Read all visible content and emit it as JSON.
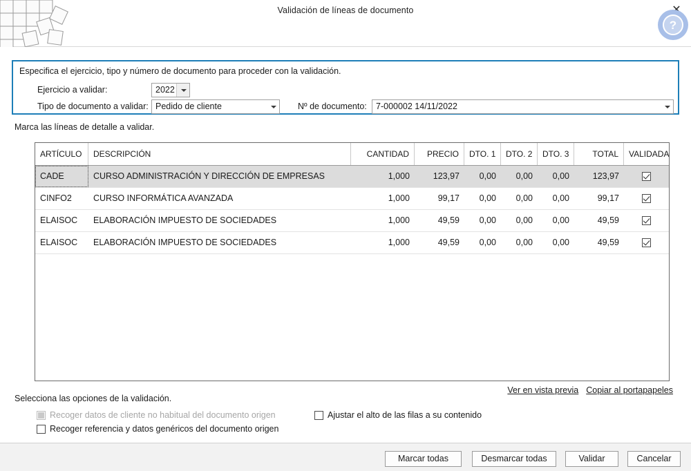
{
  "window": {
    "title": "Validación de líneas de documento",
    "close_label": "✕",
    "help_label": "?"
  },
  "info_panel": {
    "instruction": "Especifica el ejercicio, tipo y número de documento para proceder con la validación.",
    "fields": {
      "ejercicio_label": "Ejercicio a validar:",
      "ejercicio_value": "2022",
      "tipo_label": "Tipo de documento a validar:",
      "tipo_value": "Pedido de cliente",
      "numdoc_label": "Nº de documento:",
      "numdoc_value": "7-000002   14/11/2022"
    }
  },
  "grid_caption": "Marca las líneas de detalle a validar.",
  "table": {
    "columns": [
      "ARTÍCULO",
      "DESCRIPCIÓN",
      "CANTIDAD",
      "PRECIO",
      "DTO. 1",
      "DTO. 2",
      "DTO. 3",
      "TOTAL",
      "VALIDADA"
    ],
    "rows": [
      {
        "articulo": "CADE",
        "descripcion": "CURSO ADMINISTRACIÓN Y DIRECCIÓN DE EMPRESAS",
        "cantidad": "1,000",
        "precio": "123,97",
        "dto1": "0,00",
        "dto2": "0,00",
        "dto3": "0,00",
        "total": "123,97",
        "validada": true,
        "selected": true
      },
      {
        "articulo": "CINFO2",
        "descripcion": "CURSO INFORMÁTICA AVANZADA",
        "cantidad": "1,000",
        "precio": "99,17",
        "dto1": "0,00",
        "dto2": "0,00",
        "dto3": "0,00",
        "total": "99,17",
        "validada": true,
        "selected": false
      },
      {
        "articulo": "ELAISOC",
        "descripcion": "ELABORACIÓN IMPUESTO DE SOCIEDADES",
        "cantidad": "1,000",
        "precio": "49,59",
        "dto1": "0,00",
        "dto2": "0,00",
        "dto3": "0,00",
        "total": "49,59",
        "validada": true,
        "selected": false
      },
      {
        "articulo": "ELAISOC",
        "descripcion": "ELABORACIÓN IMPUESTO DE SOCIEDADES",
        "cantidad": "1,000",
        "precio": "49,59",
        "dto1": "0,00",
        "dto2": "0,00",
        "dto3": "0,00",
        "total": "49,59",
        "validada": true,
        "selected": false
      }
    ]
  },
  "links": [
    {
      "label": "Ver en vista previa"
    },
    {
      "label": "Copiar al portapapeles"
    }
  ],
  "options": {
    "caption": "Selecciona las opciones de la validación.",
    "items": [
      {
        "label": "Recoger datos de cliente no habitual del documento origen",
        "checked": false,
        "disabled": true
      },
      {
        "label": "Recoger referencia y datos genéricos del documento origen",
        "checked": false,
        "disabled": false
      },
      {
        "label": "Ajustar el alto de las filas a su contenido",
        "checked": false,
        "disabled": false
      }
    ]
  },
  "footer": {
    "marcar": "Marcar todas",
    "desmarcar": "Desmarcar todas",
    "validar": "Validar",
    "cancelar": "Cancelar"
  },
  "colors": {
    "panel_border": "#1d7eb8",
    "help_bg": "#a8bfe8",
    "row_selected": "#dcdcdc"
  }
}
